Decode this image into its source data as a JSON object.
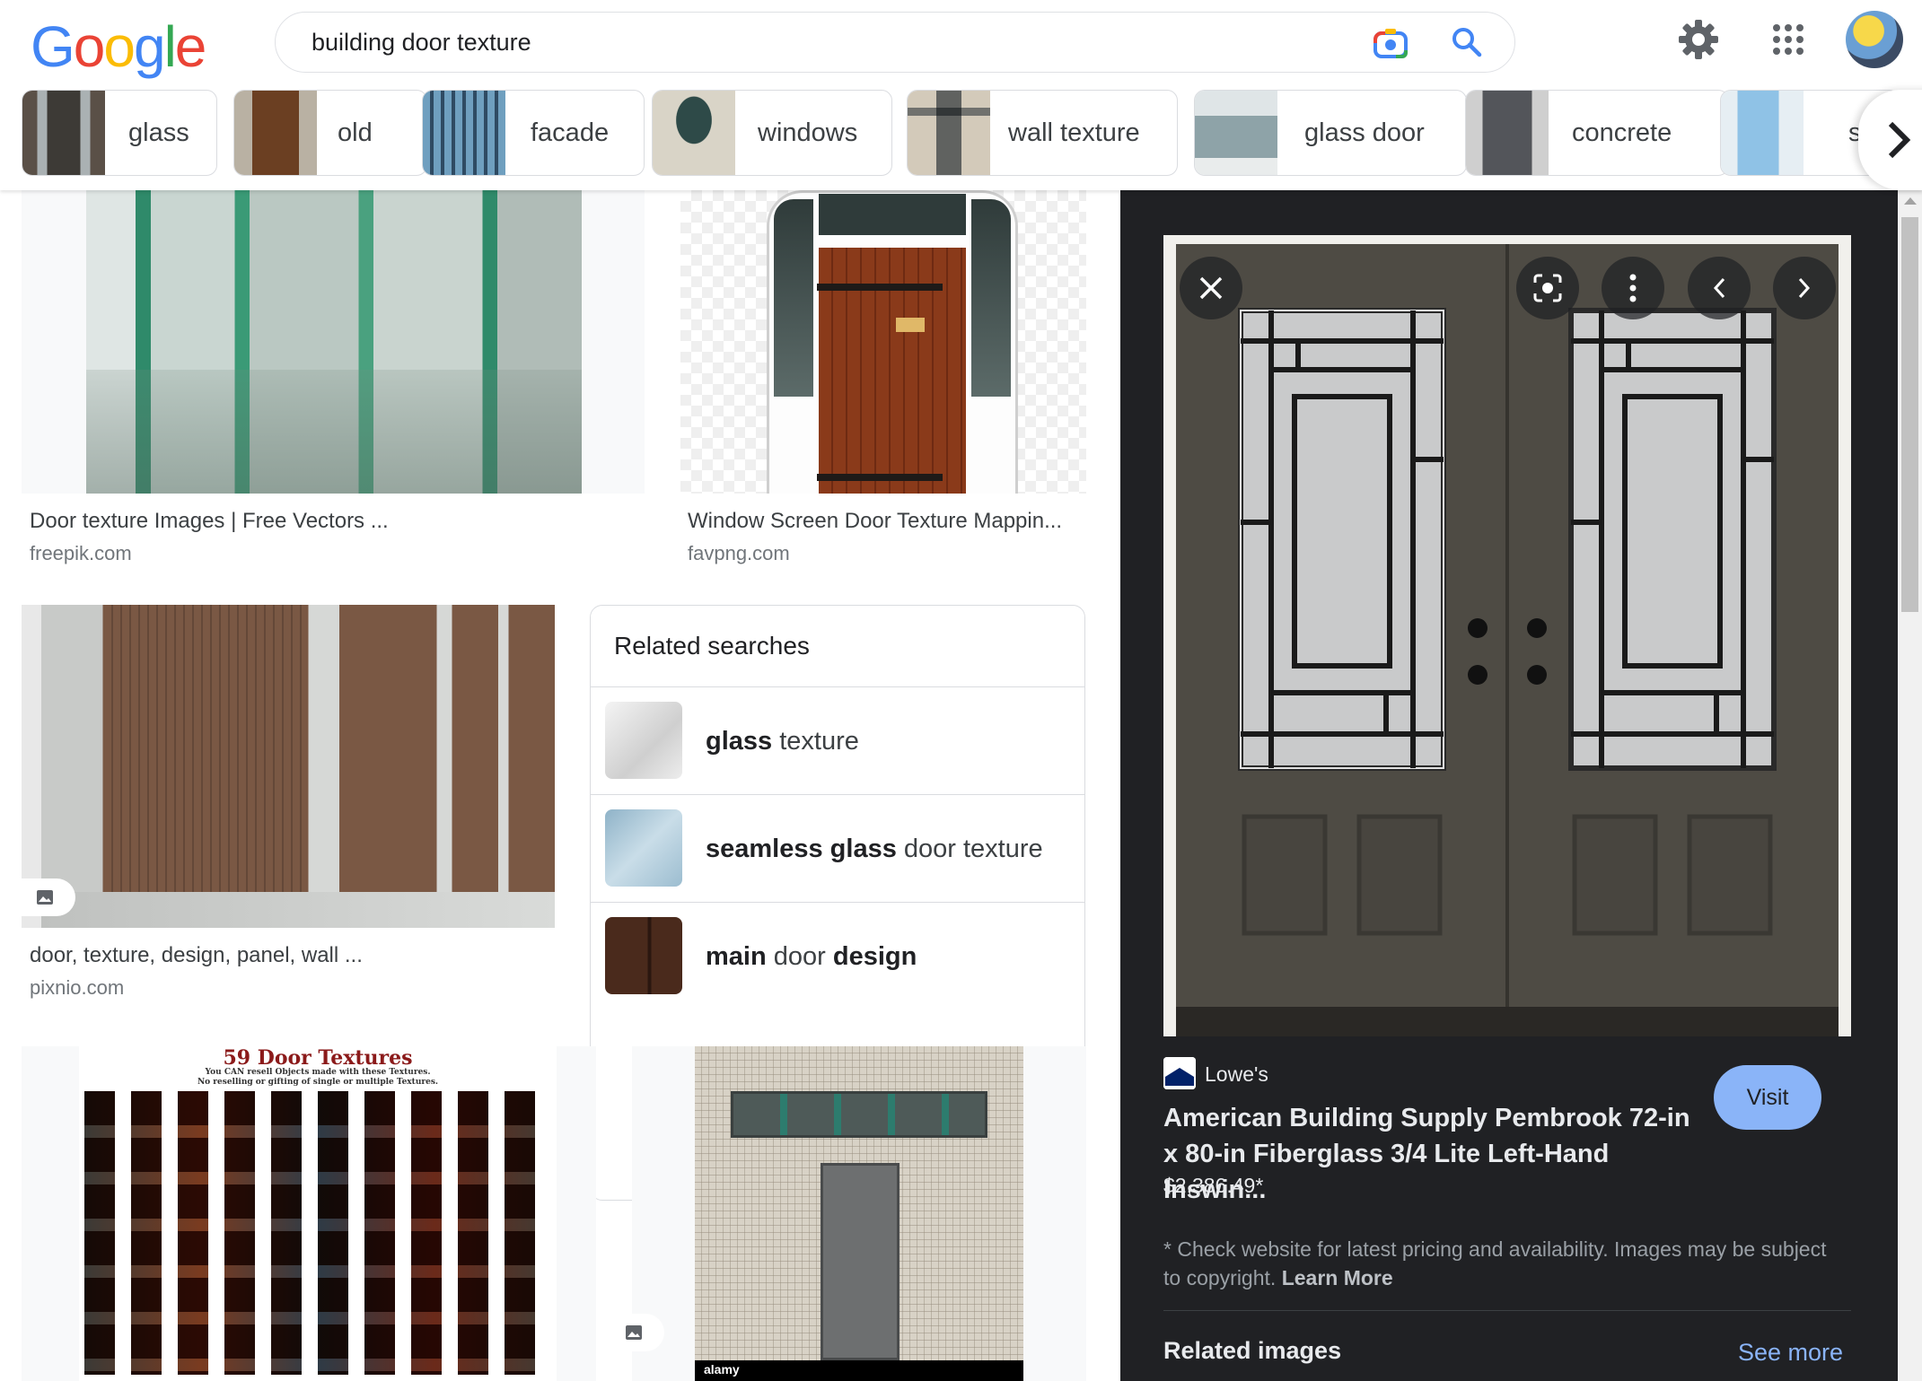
{
  "header": {
    "logo": "Google",
    "search": {
      "value": "building door texture"
    },
    "icons": [
      "camera-icon",
      "search-icon",
      "gear-icon",
      "apps-grid-icon",
      "avatar"
    ]
  },
  "chips": [
    {
      "label": "glass"
    },
    {
      "label": "old"
    },
    {
      "label": "facade"
    },
    {
      "label": "windows"
    },
    {
      "label": "wall texture"
    },
    {
      "label": "glass door"
    },
    {
      "label": "concrete"
    },
    {
      "label": "ske"
    }
  ],
  "results": [
    {
      "title": "Door texture Images | Free Vectors ...",
      "site": "freepik.com"
    },
    {
      "title": "Window Screen Door Texture Mappin...",
      "site": "favpng.com"
    },
    {
      "title": "door, texture, design, panel, wall ...",
      "site": "pixnio.com"
    }
  ],
  "collage_heading": {
    "line1": "59 Door Textures",
    "line2": "You CAN resell Objects made with these Textures.",
    "line3": "No reselling or gifting of single or multiple Textures."
  },
  "stock_watermark": "alamy",
  "related_searches": {
    "title": "Related searches",
    "items": [
      {
        "bold1": "glass",
        "normal1": " texture",
        "bold2": "",
        "normal2": ""
      },
      {
        "bold1": "seamless glass",
        "normal1": " door texture",
        "bold2": "",
        "normal2": ""
      },
      {
        "bold1": "main",
        "normal1": " door ",
        "bold2": "design",
        "normal2": ""
      }
    ]
  },
  "preview": {
    "source": "Lowe's",
    "title": "American Building Supply Pembrook 72-in x 80-in Fiberglass 3/4 Lite Left-Hand Inswin...",
    "price": "$2,386.49*",
    "visit_label": "Visit",
    "disclaimer": "* Check website for latest pricing and availability. Images may be subject to copyright. ",
    "learn_more": "Learn More",
    "related_images": "Related images",
    "see_more": "See more"
  },
  "colors": {
    "accent_blue": "#8ab4f8",
    "panel_bg": "#202124",
    "door_color": "#4e4b44"
  }
}
